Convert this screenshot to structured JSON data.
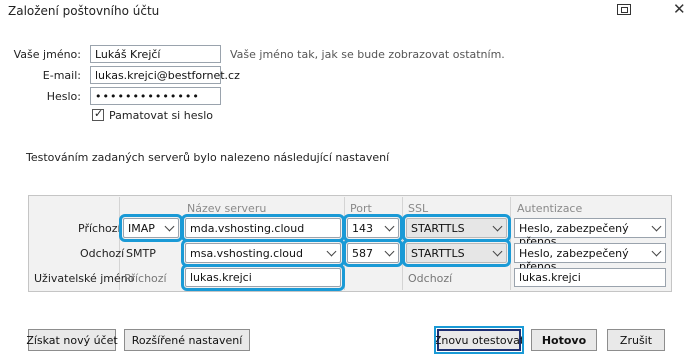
{
  "window": {
    "title": "Založení poštovního účtu"
  },
  "identity": {
    "name_label": "Vaše jméno:",
    "name_value": "Lukáš Krejčí",
    "name_hint": "Vaše jméno tak, jak se bude zobrazovat ostatním.",
    "email_label": "E-mail:",
    "email_value": "lukas.krejci@bestfornet.cz",
    "password_label": "Heslo:",
    "password_value": "••••••••••••••",
    "remember_label": "Pamatovat si heslo",
    "remember_checked": true
  },
  "found_text": "Testováním zadaných serverů bylo nalezeno následující nastavení",
  "servers": {
    "headers": {
      "server": "Název serveru",
      "port": "Port",
      "ssl": "SSL",
      "auth": "Autentizace"
    },
    "incoming": {
      "label": "Příchozí",
      "protocol": "IMAP",
      "server": "mda.vshosting.cloud",
      "port": "143",
      "ssl": "STARTTLS",
      "auth": "Heslo, zabezpečený přenos"
    },
    "outgoing": {
      "label": "Odchozí",
      "protocol": "SMTP",
      "server": "msa.vshosting.cloud",
      "port": "587",
      "ssl": "STARTTLS",
      "auth": "Heslo, zabezpečený přenos"
    },
    "username": {
      "label": "Uživatelské jméno",
      "incoming_label": "Příchozí",
      "incoming_value": "lukas.krejci",
      "outgoing_label": "Odchozí",
      "outgoing_value": "lukas.krejci"
    }
  },
  "buttons": {
    "new_account": "Získat nový účet",
    "advanced": "Rozšířené nastavení",
    "retest": "Znovu otestovat",
    "done": "Hotovo",
    "cancel": "Zrušit"
  },
  "colors": {
    "highlight": "#1a9ad6",
    "panel_bg": "#f2f2f2",
    "primary_border": "#1e2f72"
  }
}
